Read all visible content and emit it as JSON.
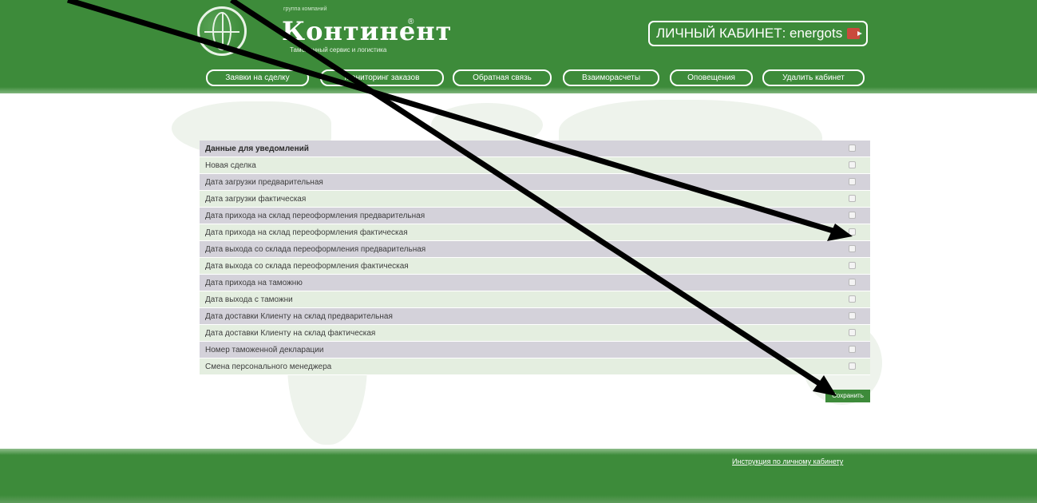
{
  "header": {
    "logo_small": "группа компаний",
    "brand": "Континент",
    "registered": "®",
    "tagline": "Таможенный сервис и логистика",
    "cabinet_label": "ЛИЧНЫЙ КАБИНЕТ: energots",
    "exit_icon": "exit-icon"
  },
  "nav": [
    {
      "label": "Заявки на сделку"
    },
    {
      "label": "Мониторинг заказов"
    },
    {
      "label": "Обратная связь"
    },
    {
      "label": "Взаиморасчеты"
    },
    {
      "label": "Оповещения"
    },
    {
      "label": "Удалить кабинет"
    }
  ],
  "table": {
    "title": "Данные для уведомлений",
    "rows": [
      {
        "label": "Новая сделка",
        "checked": false
      },
      {
        "label": "Дата загрузки предварительная",
        "checked": false
      },
      {
        "label": "Дата загрузки фактическая",
        "checked": false
      },
      {
        "label": "Дата прихода на склад переоформления предварительная",
        "checked": false
      },
      {
        "label": "Дата прихода на склад переоформления фактическая",
        "checked": false
      },
      {
        "label": "Дата выхода со склада переоформления предварительная",
        "checked": false
      },
      {
        "label": "Дата выхода со склада переоформления фактическая",
        "checked": false
      },
      {
        "label": "Дата прихода на таможню",
        "checked": false
      },
      {
        "label": "Дата выхода с таможни",
        "checked": false
      },
      {
        "label": "Дата доставки Клиенту на склад предварительная",
        "checked": false
      },
      {
        "label": "Дата доставки Клиенту на склад фактическая",
        "checked": false
      },
      {
        "label": "Номер таможенной декларации",
        "checked": false
      },
      {
        "label": "Смена персонального менеджера",
        "checked": false
      }
    ]
  },
  "save_label": "Сохранить",
  "footer": {
    "instructions_link": "Инструкция по личному кабинету"
  },
  "colors": {
    "brand_green": "#3d8b3a",
    "row_odd": "#d4d2da",
    "row_even": "#e4eee0",
    "annotation_arrow": "#000000"
  }
}
